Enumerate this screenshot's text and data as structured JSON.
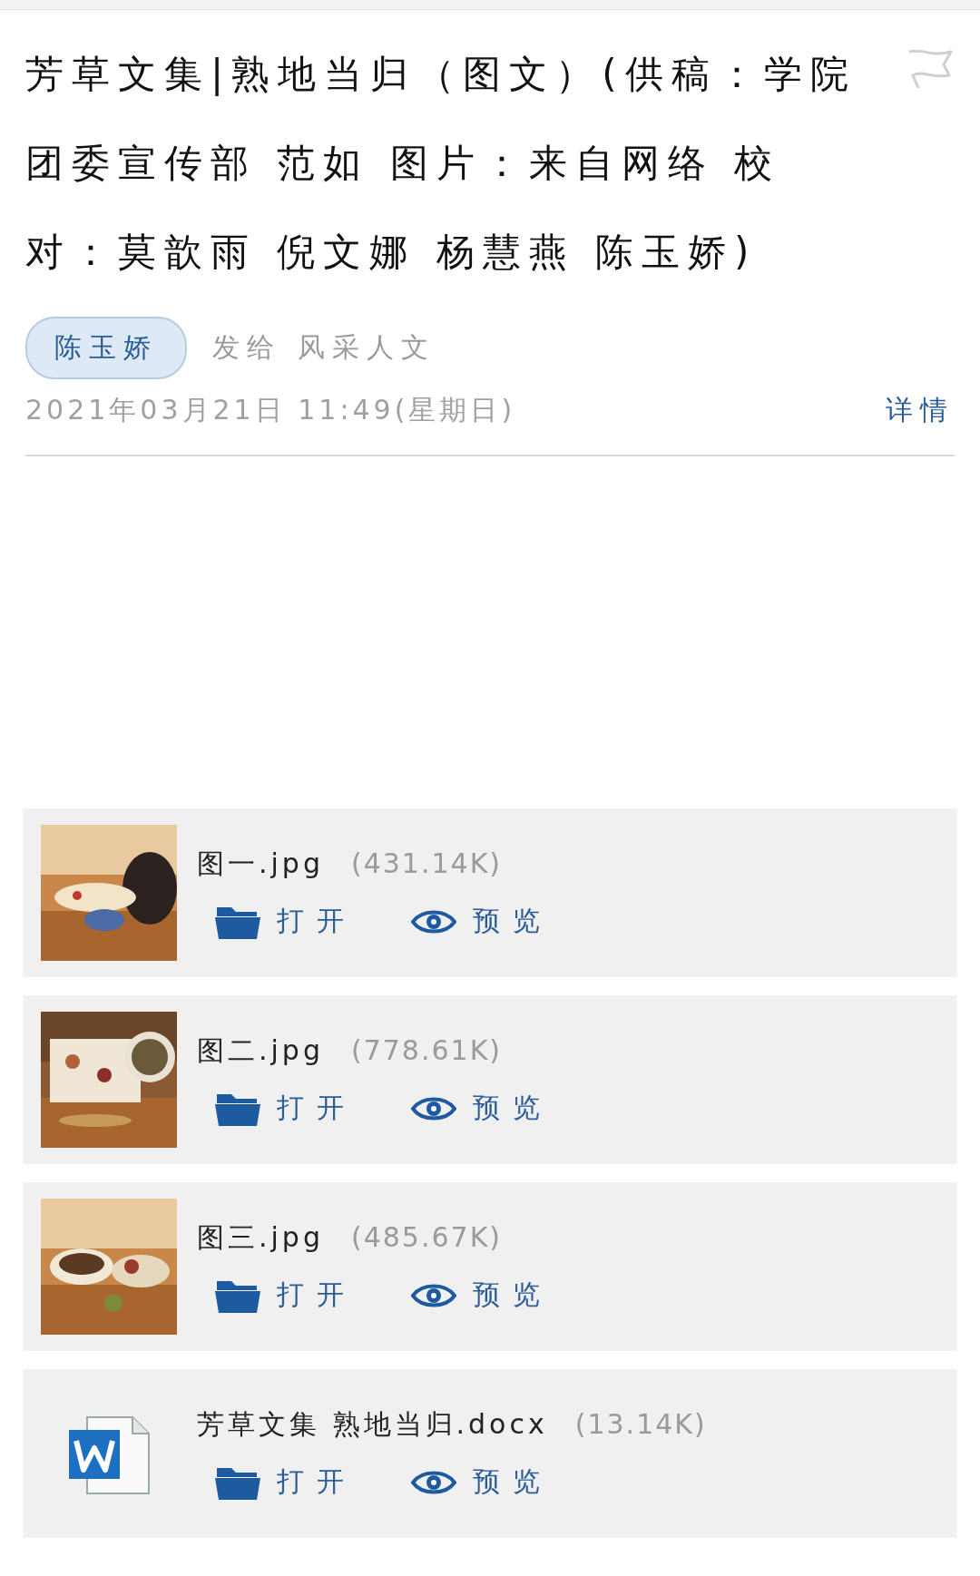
{
  "message": {
    "title": "芳草文集|熟地当归（图文）(供稿：学院团委宣传部 范如 图片：来自网络 校对：莫歆雨 倪文娜 杨慧燕 陈玉娇)",
    "sender": "陈玉娇",
    "recipient": "发给 风采人文",
    "date": "2021年03月21日 11:49(星期日)",
    "details_link": "详情"
  },
  "attachments": [
    {
      "name": "图一.jpg",
      "size": "(431.14K)",
      "actions": [
        "打开",
        "预览"
      ]
    },
    {
      "name": "图二.jpg",
      "size": "(778.61K)",
      "actions": [
        "打开",
        "预览"
      ]
    },
    {
      "name": "图三.jpg",
      "size": "(485.67K)",
      "actions": [
        "打开",
        "预览"
      ]
    },
    {
      "kind": "document",
      "name": "芳草文集 熟地当归.docx",
      "size": "(13.14K)",
      "actions": [
        "打开",
        "预览"
      ]
    }
  ]
}
